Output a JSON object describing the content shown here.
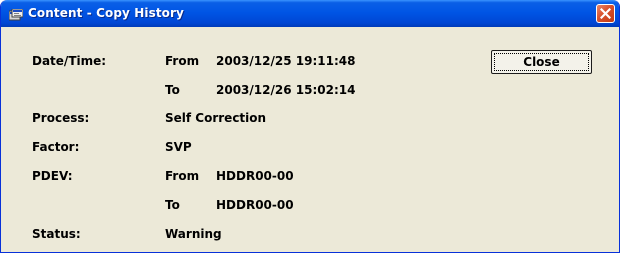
{
  "window": {
    "title": "Content - Copy History",
    "close_button_label": "Close"
  },
  "fields": {
    "datetime": {
      "label": "Date/Time:",
      "from_label": "From",
      "from_value": "2003/12/25 19:11:48",
      "to_label": "To",
      "to_value": "2003/12/26 15:02:14"
    },
    "process": {
      "label": "Process:",
      "value": "Self Correction"
    },
    "factor": {
      "label": "Factor:",
      "value": "SVP"
    },
    "pdev": {
      "label": "PDEV:",
      "from_label": "From",
      "from_value": "HDDR00-00",
      "to_label": "To",
      "to_value": "HDDR00-00"
    },
    "status": {
      "label": "Status:",
      "value": "Warning"
    }
  },
  "colors": {
    "title_bar": "#0055e5",
    "client_bg": "#ece9d8",
    "close_x": "#d8502c"
  }
}
